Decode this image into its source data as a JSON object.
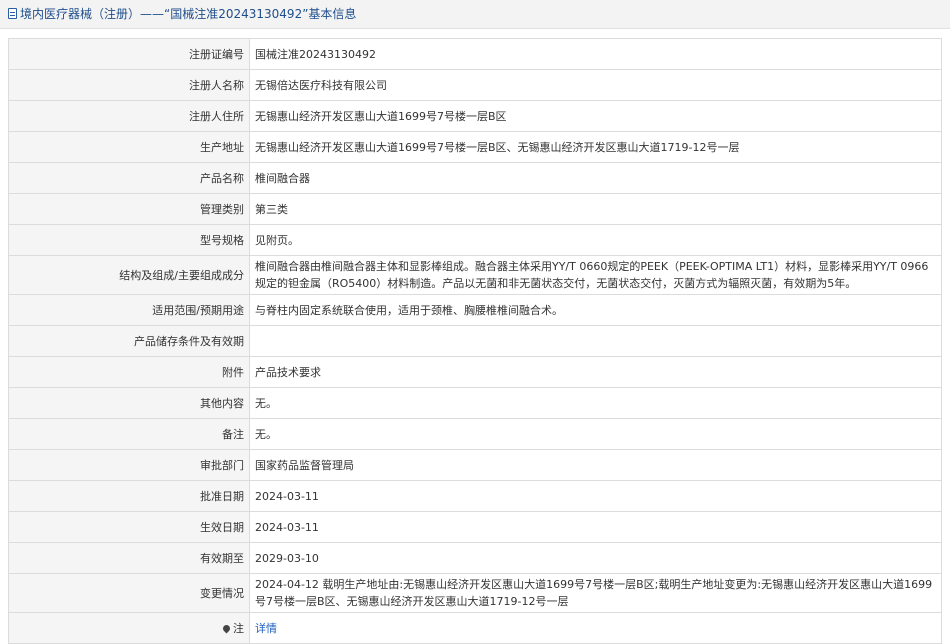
{
  "header": {
    "title": "境内医疗器械（注册）——“国械注准20243130492”基本信息"
  },
  "rows": [
    {
      "label": "注册证编号",
      "value": "国械注准20243130492"
    },
    {
      "label": "注册人名称",
      "value": "无锡倍达医疗科技有限公司"
    },
    {
      "label": "注册人住所",
      "value": "无锡惠山经济开发区惠山大道1699号7号楼一层B区"
    },
    {
      "label": "生产地址",
      "value": "无锡惠山经济开发区惠山大道1699号7号楼一层B区、无锡惠山经济开发区惠山大道1719-12号一层"
    },
    {
      "label": "产品名称",
      "value": "椎间融合器"
    },
    {
      "label": "管理类别",
      "value": "第三类"
    },
    {
      "label": "型号规格",
      "value": "见附页。"
    },
    {
      "label": "结构及组成/主要组成成分",
      "value": "椎间融合器由椎间融合器主体和显影棒组成。融合器主体采用YY/T 0660规定的PEEK（PEEK-OPTIMA LT1）材料，显影棒采用YY/T 0966规定的钽金属（RO5400）材料制造。产品以无菌和非无菌状态交付，无菌状态交付，灭菌方式为辐照灭菌，有效期为5年。"
    },
    {
      "label": "适用范围/预期用途",
      "value": "与脊柱内固定系统联合使用，适用于颈椎、胸腰椎椎间融合术。"
    },
    {
      "label": "产品储存条件及有效期",
      "value": ""
    },
    {
      "label": "附件",
      "value": "产品技术要求"
    },
    {
      "label": "其他内容",
      "value": "无。"
    },
    {
      "label": "备注",
      "value": "无。"
    },
    {
      "label": "审批部门",
      "value": "国家药品监督管理局"
    },
    {
      "label": "批准日期",
      "value": "2024-03-11"
    },
    {
      "label": "生效日期",
      "value": "2024-03-11"
    },
    {
      "label": "有效期至",
      "value": "2029-03-10"
    },
    {
      "label": "变更情况",
      "value": "2024-04-12 载明生产地址由:无锡惠山经济开发区惠山大道1699号7号楼一层B区;载明生产地址变更为:无锡惠山经济开发区惠山大道1699号7号楼一层B区、无锡惠山经济开发区惠山大道1719-12号一层"
    }
  ],
  "note": {
    "label": "注",
    "link_text": "详情",
    "icon": "pin-icon"
  }
}
